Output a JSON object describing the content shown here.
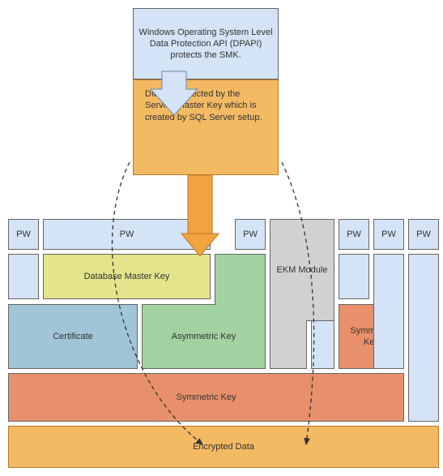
{
  "diagram": {
    "top_box": "Windows Operating System Level Data Protection API (DPAPI) protects the SMK.",
    "dmk_box": "DMK is protected by the Service Master Key which is created by SQL Server setup.",
    "pw_label": "PW",
    "database_master_key": "Database Master Key",
    "ekm_module": "EKM Module",
    "certificate": "Certificate",
    "asymmetric_key": "Asymmetric Key",
    "symmetric_key_small": "Symmetric Key",
    "symmetric_key_wide": "Symmetric Key",
    "encrypted_data": "Encrypted Data"
  }
}
